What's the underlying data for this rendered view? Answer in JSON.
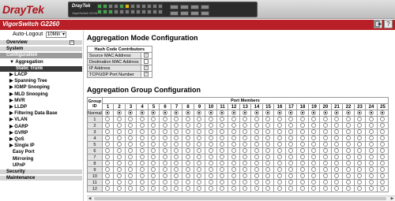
{
  "header": {
    "logo": "DrayTek",
    "panel_brand": "DrayTek",
    "panel_model": "VigorSwitch G2260",
    "product_name": "VigorSwitch G2260"
  },
  "toolbar": {
    "logout_icon": "exit-icon",
    "help_label": "?"
  },
  "sidebar": {
    "autologout_label": "Auto-Logout",
    "autologout_value": "10Min",
    "collapse_label": "−",
    "items": [
      {
        "label": "Overview",
        "kind": "section"
      },
      {
        "label": "System",
        "kind": "section"
      },
      {
        "label": "Configuration",
        "kind": "active-section"
      },
      {
        "label": "▼ Aggregation",
        "kind": "sub"
      },
      {
        "label": "Static Trunk",
        "kind": "selected"
      },
      {
        "label": "▶ LACP",
        "kind": "sub"
      },
      {
        "label": "▶ Spanning Tree",
        "kind": "sub"
      },
      {
        "label": "▶ IGMP Snooping",
        "kind": "sub"
      },
      {
        "label": "▶ MLD Snooping",
        "kind": "sub"
      },
      {
        "label": "▶ MVR",
        "kind": "sub"
      },
      {
        "label": "▶ LLDP",
        "kind": "sub"
      },
      {
        "label": "▶ Filtering Data Base",
        "kind": "sub"
      },
      {
        "label": "▶ VLAN",
        "kind": "sub"
      },
      {
        "label": "▶ GARP",
        "kind": "sub"
      },
      {
        "label": "▶ GVRP",
        "kind": "sub"
      },
      {
        "label": "▶ QoS",
        "kind": "sub"
      },
      {
        "label": "▶ Single IP",
        "kind": "sub"
      },
      {
        "label": "Easy Port",
        "kind": "sub"
      },
      {
        "label": "Mirroring",
        "kind": "sub"
      },
      {
        "label": "UPnP",
        "kind": "sub"
      },
      {
        "label": "Security",
        "kind": "section"
      },
      {
        "label": "Maintenance",
        "kind": "section"
      }
    ]
  },
  "main": {
    "mode_title": "Aggregation Mode Configuration",
    "hash_header": "Hash Code Contributors",
    "hash_rows": [
      {
        "label": "Source MAC Address",
        "checked": true
      },
      {
        "label": "Destination MAC Address",
        "checked": false
      },
      {
        "label": "IP Address",
        "checked": true
      },
      {
        "label": "TCP/UDP Port Number",
        "checked": true
      }
    ],
    "group_title": "Aggregation Group Configuration",
    "group_id_header": "Group ID",
    "port_members_header": "Port Members",
    "port_numbers": [
      "1",
      "2",
      "3",
      "4",
      "5",
      "6",
      "7",
      "8",
      "9",
      "10",
      "11",
      "12",
      "13",
      "14",
      "15",
      "16",
      "17",
      "18",
      "19",
      "20",
      "21",
      "22",
      "23",
      "24",
      "25"
    ],
    "group_rows": [
      "Normal",
      "1",
      "2",
      "3",
      "4",
      "5",
      "6",
      "7",
      "8",
      "9",
      "10",
      "11",
      "12"
    ]
  },
  "colors": {
    "brand_red": "#b81f26",
    "menu_section": "#d3d3d3",
    "selected": "#3a3a3a"
  }
}
